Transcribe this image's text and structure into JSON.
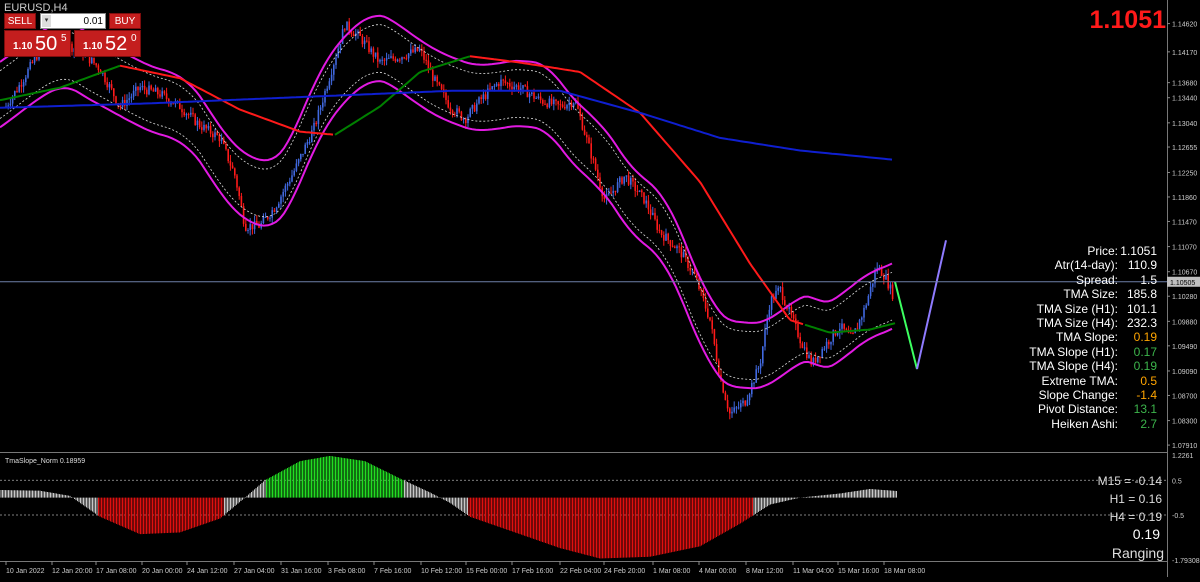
{
  "window": {
    "title": "EURUSD,H4"
  },
  "trade_panel": {
    "sell_label": "SELL",
    "buy_label": "BUY",
    "volume": "0.01",
    "sell_price": {
      "prefix": "1.10",
      "big": "50",
      "sup": "5"
    },
    "buy_price": {
      "prefix": "1.10",
      "big": "52",
      "sup": "0"
    }
  },
  "current_price": "1.1051",
  "current_price_tag": "1.10505",
  "price_axis": {
    "labels": [
      "1.14620",
      "1.14170",
      "1.13680",
      "1.13440",
      "1.13040",
      "1.12655",
      "1.12250",
      "1.11860",
      "1.11470",
      "1.11070",
      "1.10670",
      "1.10280",
      "1.09880",
      "1.09490",
      "1.09090",
      "1.08700",
      "1.08300",
      "1.07910"
    ],
    "values": [
      1.1462,
      1.1417,
      1.1368,
      1.1344,
      1.1304,
      1.12655,
      1.1225,
      1.1186,
      1.1147,
      1.1107,
      1.1067,
      1.1028,
      1.0988,
      1.0949,
      1.0909,
      1.087,
      1.083,
      1.0791
    ],
    "range": [
      1.078,
      1.149
    ]
  },
  "indicator_axis": {
    "labels": [
      "1.2261",
      "0.5",
      "-0.5",
      "-1.79308"
    ],
    "values": [
      1.2261,
      0.5,
      -0.5,
      -1.79308
    ]
  },
  "time_axis": [
    "10 Jan 2022",
    "12 Jan 20:00",
    "17 Jan 08:00",
    "20 Jan 00:00",
    "24 Jan 12:00",
    "27 Jan 04:00",
    "31 Jan 16:00",
    "3 Feb 08:00",
    "7 Feb 16:00",
    "10 Feb 12:00",
    "15 Feb 00:00",
    "17 Feb 16:00",
    "22 Feb 04:00",
    "24 Feb 20:00",
    "1 Mar 08:00",
    "4 Mar 00:00",
    "8 Mar 12:00",
    "11 Mar 04:00",
    "15 Mar 16:00",
    "18 Mar 08:00"
  ],
  "info_panel": [
    {
      "label": "Price:",
      "value": "1.1051",
      "color": "#ffffff"
    },
    {
      "label": "Atr(14-day):",
      "value": "110.9",
      "color": "#ffffff"
    },
    {
      "label": "Spread:",
      "value": "1.5",
      "color": "#ffffff"
    },
    {
      "label": "TMA Size:",
      "value": "185.8",
      "color": "#ffffff"
    },
    {
      "label": "TMA Size (H1):",
      "value": "101.1",
      "color": "#ffffff"
    },
    {
      "label": "TMA Size (H4):",
      "value": "232.3",
      "color": "#ffffff"
    },
    {
      "label": "TMA Slope:",
      "value": "0.19",
      "color": "#ffa500"
    },
    {
      "label": "TMA Slope (H1):",
      "value": "0.17",
      "color": "#3cb44b"
    },
    {
      "label": "TMA Slope (H4):",
      "value": "0.19",
      "color": "#3cb44b"
    },
    {
      "label": "Extreme TMA:",
      "value": "0.5",
      "color": "#ffa500"
    },
    {
      "label": "Slope Change:",
      "value": "-1.4",
      "color": "#ffa500"
    },
    {
      "label": "Pivot Distance:",
      "value": "13.1",
      "color": "#3cb44b"
    },
    {
      "label": "Heiken Ashi:",
      "value": "2.7",
      "color": "#3cb44b"
    }
  ],
  "indicator": {
    "title": "TmaSlope_Norm 0.18959",
    "mtf": [
      "M15 = -0.14",
      "H1 = 0.16",
      "H4 = 0.19"
    ],
    "current": "0.19",
    "state": "Ranging"
  },
  "colors": {
    "bull": "#4169e1",
    "bear": "#ff1a1a",
    "band": "#e21ae2",
    "tma_up": "#008000",
    "tma_down": "#ff1a1a",
    "long_ma": "#0f1fd0",
    "hist_pos": "#22dd22",
    "hist_neg": "#e01010",
    "hist_neutral": "#c8c8c8"
  }
}
